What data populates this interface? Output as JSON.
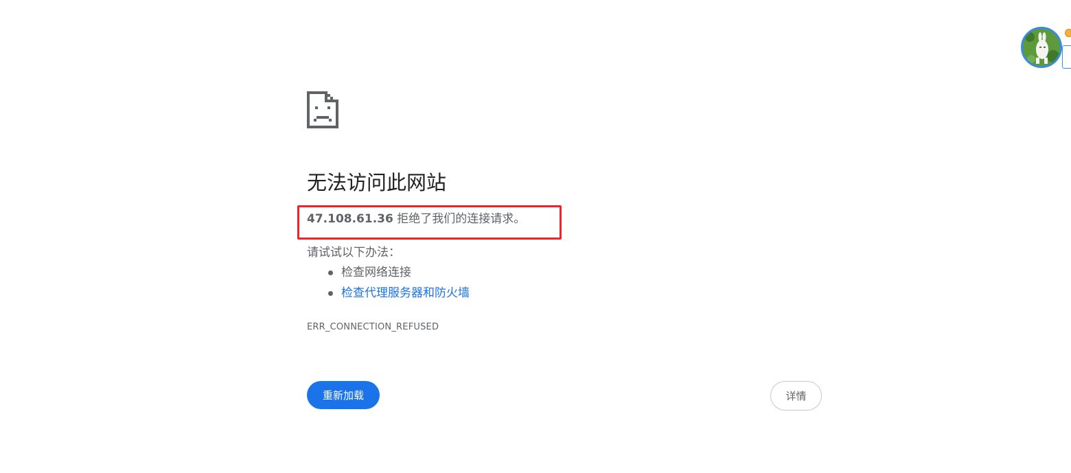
{
  "error_page": {
    "title": "无法访问此网站",
    "host": "47.108.61.36",
    "message_suffix": " 拒绝了我们的连接请求。",
    "suggestions_heading": "请试试以下办法：",
    "suggestions": [
      {
        "label": "检查网络连接",
        "is_link": false
      },
      {
        "label": "检查代理服务器和防火墙",
        "is_link": true
      }
    ],
    "error_code": "ERR_CONNECTION_REFUSED",
    "reload_label": "重新加载",
    "details_label": "详情"
  },
  "annotation": {
    "highlight_color": "#e8262b"
  },
  "colors": {
    "accent": "#1a73e8",
    "text_secondary": "#5f6368",
    "text_primary": "#202124"
  },
  "icons": {
    "error": "sad-page-icon",
    "avatar": "avatar-icon"
  }
}
